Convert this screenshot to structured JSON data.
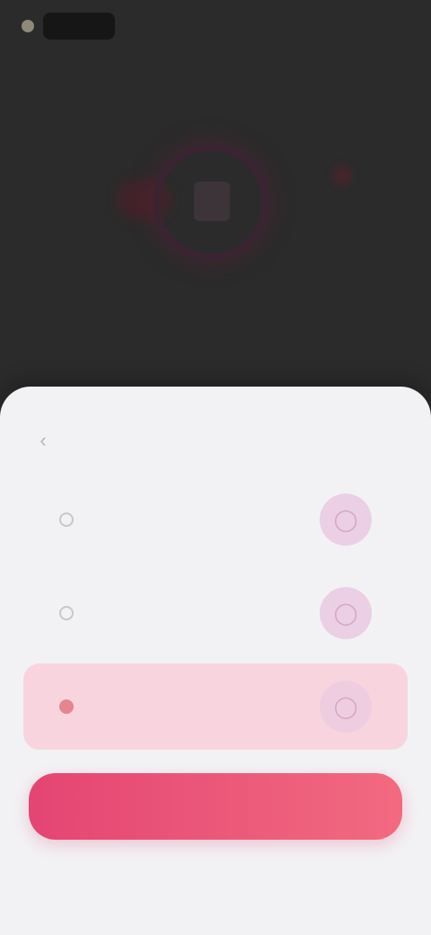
{
  "status_bar": {
    "time": "",
    "indicator_icon": "camera-dot-icon"
  },
  "background": {
    "caption": "",
    "subtitle": "",
    "hero_icon": "device-ring-icon",
    "accent_color": "#3a2432"
  },
  "sheet": {
    "title": "",
    "back_icon": "chevron-left-icon",
    "options": [
      {
        "title": "",
        "subtitle": "",
        "icon": "option-icon",
        "selected": false
      },
      {
        "title": "",
        "subtitle": "",
        "icon": "option-icon",
        "selected": false
      },
      {
        "title": "",
        "subtitle": "",
        "icon": "option-icon",
        "selected": true
      }
    ],
    "cta_label": "",
    "footnote": ""
  },
  "colors": {
    "sheet_bg": "#f2f2f4",
    "selected_bg": "#f8d5de",
    "cta_start": "#e44573",
    "cta_end": "#f26a80",
    "icon_bg": "#ebcfe4"
  }
}
